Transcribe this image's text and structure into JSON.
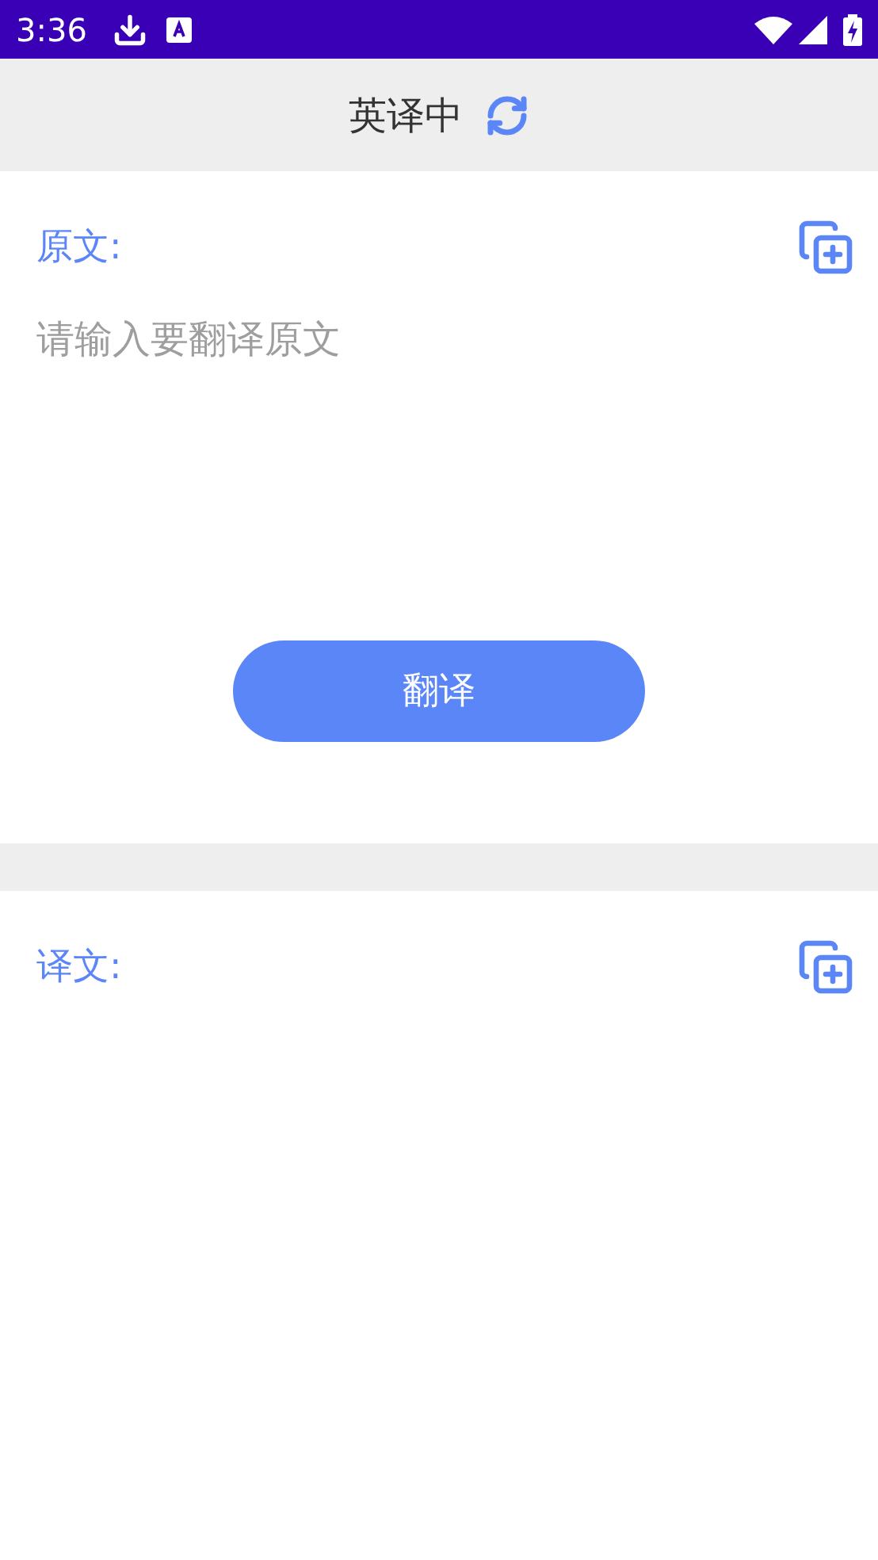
{
  "status_bar": {
    "time": "3:36"
  },
  "header": {
    "title": "英译中"
  },
  "source": {
    "label": "原文:",
    "placeholder": "请输入要翻译原文"
  },
  "translate_button": {
    "label": "翻译"
  },
  "result": {
    "label": "译文:"
  }
}
